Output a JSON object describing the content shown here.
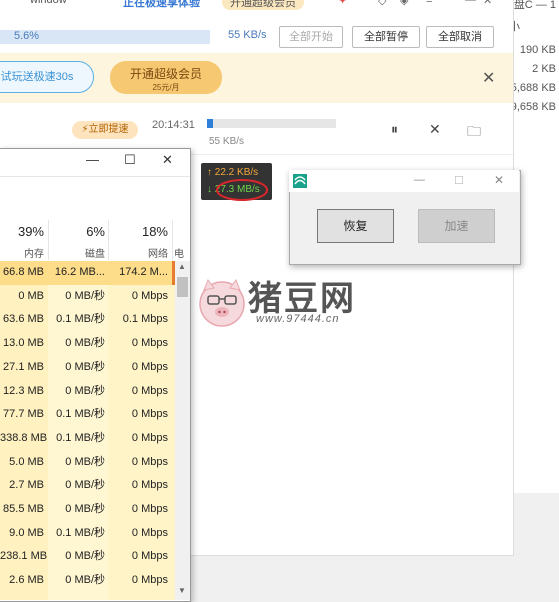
{
  "bg_window": {
    "lines": [
      "盘C — 1",
      "小",
      "190 KB",
      "2 KB",
      "5,688 KB",
      "9,658 KB"
    ]
  },
  "downloader": {
    "top_labels": [
      "window",
      "正在极速享体验",
      "开通超级会员"
    ],
    "speed_percent": "5.6%",
    "speed_rate": "55 KB/s",
    "buttons": {
      "start_all": "全部开始",
      "pause_all": "全部暂停",
      "cancel_all": "全部取消"
    },
    "promo": {
      "trial": "试玩送极速30s",
      "vip_title": "开通超级会员",
      "vip_price": "25元/月"
    },
    "task": {
      "boost": "立即提速",
      "time": "20:14:31",
      "rate": "55 KB/s",
      "progress": 0.05
    }
  },
  "task_manager": {
    "columns": [
      {
        "pct": "39%",
        "label": "内存"
      },
      {
        "pct": "6%",
        "label": "磁盘"
      },
      {
        "pct": "18%",
        "label": "网络"
      },
      {
        "pct": "",
        "label": "电"
      }
    ],
    "rows": [
      [
        "66.8 MB",
        "16.2 MB...",
        "174.2 M..."
      ],
      [
        "0 MB",
        "0 MB/秒",
        "0 Mbps"
      ],
      [
        "63.6 MB",
        "0.1 MB/秒",
        "0.1 Mbps"
      ],
      [
        "13.0 MB",
        "0 MB/秒",
        "0 Mbps"
      ],
      [
        "27.1 MB",
        "0 MB/秒",
        "0 Mbps"
      ],
      [
        "12.3 MB",
        "0 MB/秒",
        "0 Mbps"
      ],
      [
        "77.7 MB",
        "0.1 MB/秒",
        "0 Mbps"
      ],
      [
        "338.8 MB",
        "0.1 MB/秒",
        "0 Mbps"
      ],
      [
        "5.0 MB",
        "0 MB/秒",
        "0 Mbps"
      ],
      [
        "2.7 MB",
        "0 MB/秒",
        "0 Mbps"
      ],
      [
        "85.5 MB",
        "0 MB/秒",
        "0 Mbps"
      ],
      [
        "9.0 MB",
        "0.1 MB/秒",
        "0 Mbps"
      ],
      [
        "238.1 MB",
        "0 MB/秒",
        "0 Mbps"
      ],
      [
        "2.6 MB",
        "0 MB/秒",
        "0 Mbps"
      ]
    ]
  },
  "speed_widget": {
    "up": "↑ 22.2 KB/s",
    "down": "↓ 27.3 MB/s"
  },
  "dialog": {
    "resume": "恢复",
    "accelerate": "加速"
  },
  "watermark": {
    "text": "猪豆网",
    "url": "www.97444.cn"
  },
  "colors": {
    "accent_blue": "#2e7fd8",
    "vip_gold": "#f7c872",
    "promo_bg": "#fdf5de",
    "tm_highlight": "#fff4c4",
    "annotation_red": "#d9262b"
  }
}
